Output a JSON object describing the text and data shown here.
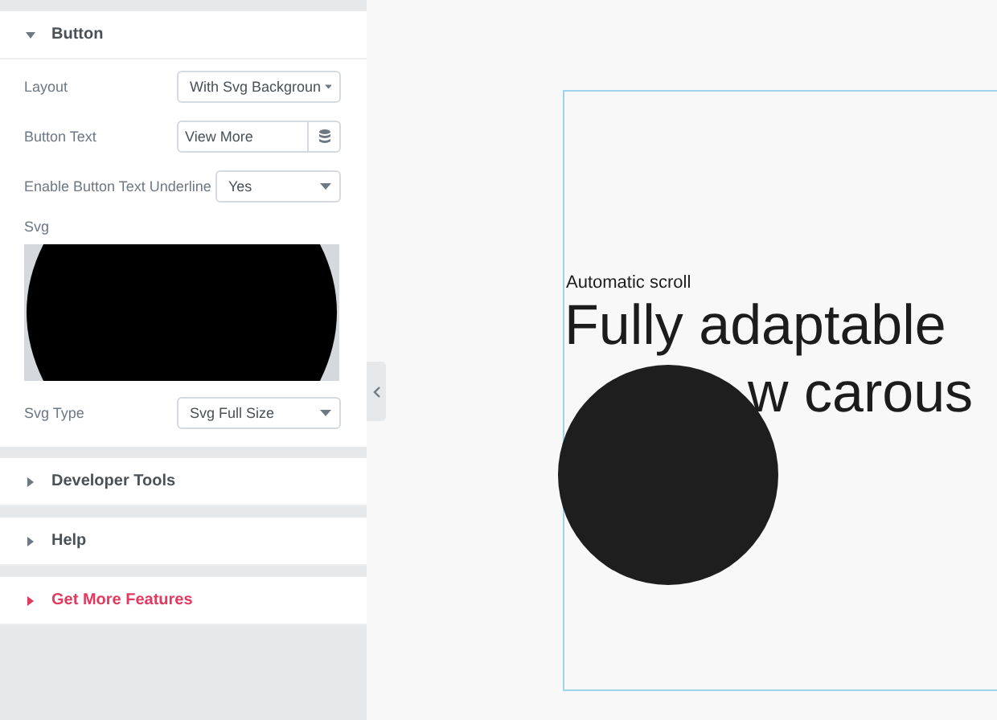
{
  "panel": {
    "sections": [
      {
        "title": "Button",
        "expanded": true,
        "kind": "normal",
        "controls": [
          {
            "kind": "select",
            "label": "Layout",
            "value": "With Svg Backgroun"
          },
          {
            "kind": "text",
            "label": "Button Text",
            "value": "View More"
          },
          {
            "kind": "select",
            "label": "Enable Button Text Underline",
            "value": "Yes"
          },
          {
            "kind": "svg",
            "label": "Svg"
          },
          {
            "kind": "select",
            "label": "Svg Type",
            "value": "Svg Full Size"
          }
        ]
      },
      {
        "title": "Developer Tools",
        "expanded": false,
        "kind": "normal"
      },
      {
        "title": "Help",
        "expanded": false,
        "kind": "normal"
      },
      {
        "title": "Get More Features",
        "expanded": false,
        "kind": "promo"
      }
    ]
  },
  "preview": {
    "eyebrow": "Automatic scroll",
    "headline": [
      "Fully adaptable",
      "w carous"
    ]
  }
}
